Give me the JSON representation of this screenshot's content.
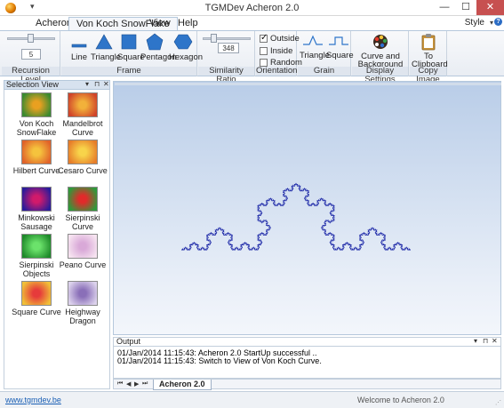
{
  "window": {
    "title": "TGMDev Acheron 2.0",
    "minimize_glyph": "—",
    "maximize_glyph": "☐",
    "close_glyph": "✕",
    "qat_glyph": "▾"
  },
  "tabs": [
    {
      "label": "Acheron",
      "active": false
    },
    {
      "label": "Von Koch SnowFlake",
      "active": true
    },
    {
      "label": "View",
      "active": false
    },
    {
      "label": "Help",
      "active": false
    }
  ],
  "style_menu": {
    "label": "Style",
    "arrow": "▾",
    "help": "?"
  },
  "ribbon": {
    "recursion": {
      "value": "5",
      "label": "Recursion Level"
    },
    "frame": {
      "label": "Frame",
      "buttons": [
        "Line",
        "Triangle",
        "Square",
        "Pentagon",
        "Hexagon"
      ]
    },
    "similarity": {
      "value": "348",
      "label": "Similarity Ratio"
    },
    "orientation": {
      "label": "Orientation",
      "options": [
        {
          "label": "Outside",
          "checked": true
        },
        {
          "label": "Inside",
          "checked": false
        },
        {
          "label": "Random",
          "checked": false
        }
      ]
    },
    "grain": {
      "label": "Grain",
      "buttons": [
        "Triangle",
        "Square"
      ]
    },
    "display": {
      "label": "Display Settings",
      "button_line1": "Curve and",
      "button_line2": "Background Color"
    },
    "copy": {
      "label": "Copy Image",
      "button_line1": "To",
      "button_line2": "Clipboard"
    }
  },
  "selection_view": {
    "title": "Selection View",
    "items": [
      {
        "line1": "Von Koch",
        "line2": "SnowFlake",
        "icon": "vonkoch-thumb-icon",
        "c1": "#e9a020",
        "c2": "#3a8a30"
      },
      {
        "line1": "Mandelbrot",
        "line2": "Curve",
        "icon": "mandelbrot-thumb-icon",
        "c1": "#f2b13a",
        "c2": "#d0442a"
      },
      {
        "line1": "Hilbert Curve",
        "line2": "",
        "icon": "hilbert-thumb-icon",
        "c1": "#f5c33d",
        "c2": "#e0632a"
      },
      {
        "line1": "Cesaro Curve",
        "line2": "",
        "icon": "cesaro-thumb-icon",
        "c1": "#f8d44a",
        "c2": "#e67d2a"
      },
      {
        "line1": "Minkowski",
        "line2": "Sausage",
        "icon": "minkowski-thumb-icon",
        "c1": "#d11a6b",
        "c2": "#2a1c9a"
      },
      {
        "line1": "Sierpinski Curve",
        "line2": "",
        "icon": "sierpinski-curve-thumb-icon",
        "c1": "#e12a2a",
        "c2": "#2e9a3a"
      },
      {
        "line1": "Sierpinski",
        "line2": "Objects",
        "icon": "sierpinski-objects-thumb-icon",
        "c1": "#6be26b",
        "c2": "#1f8a2a"
      },
      {
        "line1": "Peano Curve",
        "line2": "",
        "icon": "peano-thumb-icon",
        "c1": "#d9a9d8",
        "c2": "#f6e3f0"
      },
      {
        "line1": "Square Curve",
        "line2": "",
        "icon": "square-curve-thumb-icon",
        "c1": "#e63b3b",
        "c2": "#f0c038"
      },
      {
        "line1": "Heighway",
        "line2": "Dragon",
        "icon": "dragon-thumb-icon",
        "c1": "#8a6fb8",
        "c2": "#dcd2ec"
      }
    ]
  },
  "output": {
    "title": "Output",
    "lines": [
      "01/Jan/2014 11:15:43: Acheron 2.0 StartUp successful ..",
      "01/Jan/2014 11:15:43: Switch to View of Von Koch Curve."
    ],
    "tab": "Acheron 2.0"
  },
  "panel_controls": {
    "pin": "▾",
    "dock": "⊓",
    "close": "✕"
  },
  "nav_arrows": [
    "⏮",
    "◀",
    "▶",
    "⏭"
  ],
  "status": {
    "link": "www.tgmdev.be",
    "message": "Welcome to Acheron 2.0"
  },
  "fractal": {
    "type": "von-koch-curve",
    "recursion_level": 5,
    "color": "#1f2aa8"
  }
}
